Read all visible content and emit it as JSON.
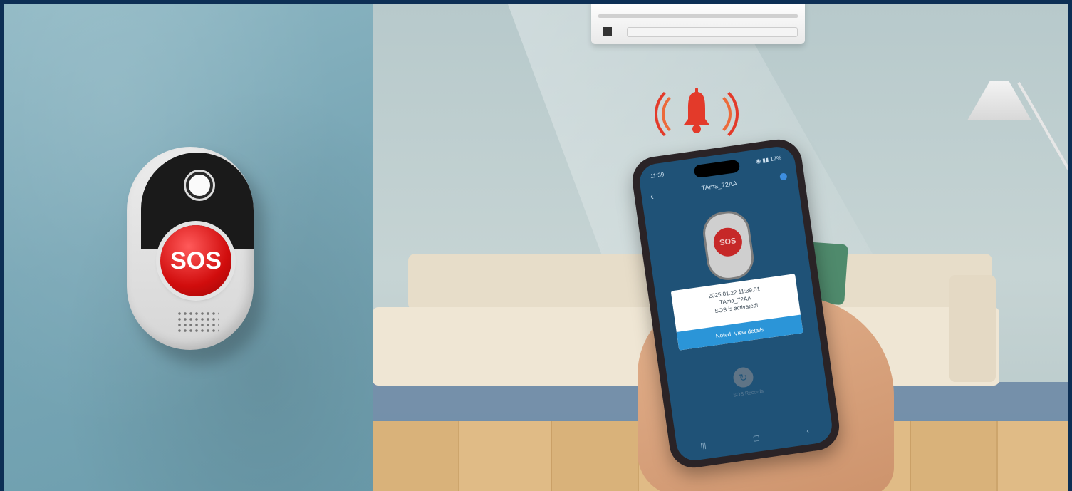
{
  "left_panel": {
    "device_button_label": "SOS"
  },
  "phone": {
    "status_time": "11:39",
    "status_icons": "◉ ▮▮ 17%",
    "title": "TAma_72AA",
    "device_button_label": "SOS",
    "alert": {
      "timestamp": "2025.01.22 11:39:01",
      "device": "TAma_72AA",
      "message": "SOS is activated!",
      "button_label": "Noted, View details"
    },
    "history_label": "SOS Records",
    "nav": [
      "|||",
      "▢",
      "‹"
    ]
  },
  "colors": {
    "frame": "#0d2f55",
    "alert_red": "#e33a2a",
    "app_background": "#1f5277",
    "accent_blue": "#2b95d8"
  }
}
